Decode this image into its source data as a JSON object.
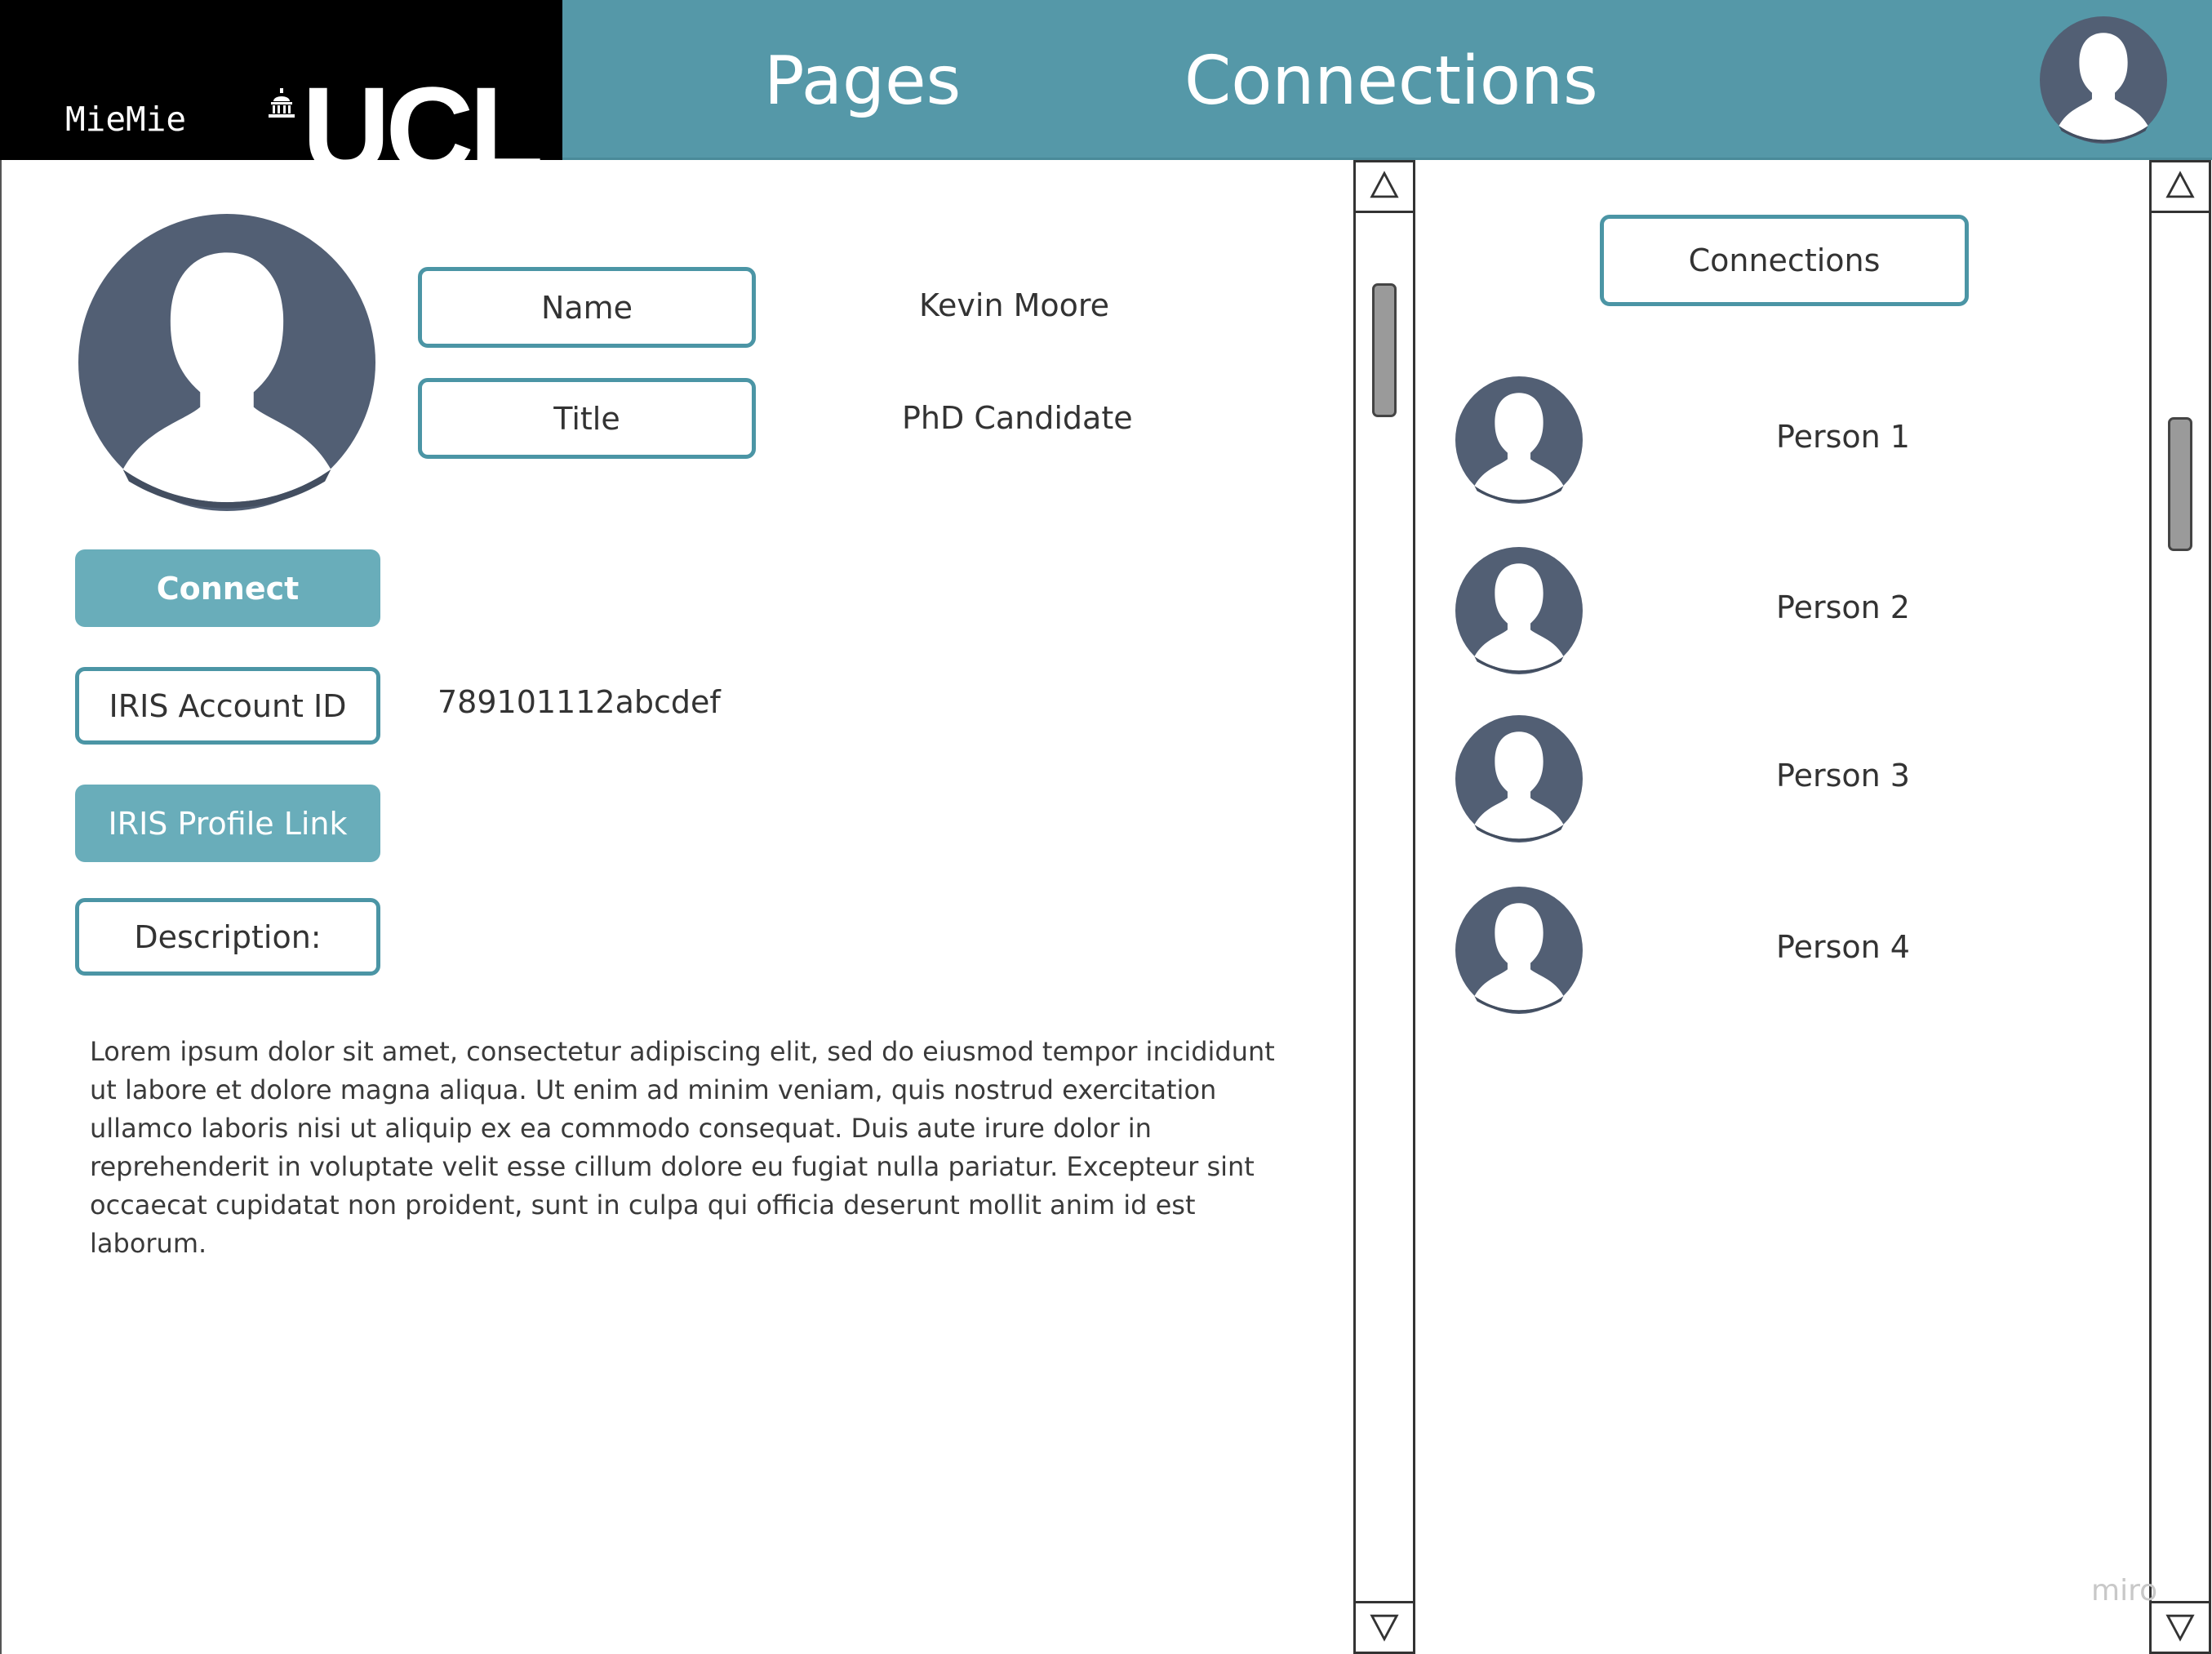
{
  "header": {
    "app_name": "MieMie",
    "logo_text": "UCL",
    "nav": [
      {
        "label": "Pages"
      },
      {
        "label": "Connections"
      }
    ]
  },
  "profile": {
    "name_label": "Name",
    "name_value": "Kevin Moore",
    "title_label": "Title",
    "title_value": "PhD Candidate",
    "connect_button": "Connect",
    "iris_id_label": "IRIS Account ID",
    "iris_id_value": "789101112abcdef",
    "iris_link_button": "IRIS Profile Link",
    "description_label": "Description:",
    "description_text": "Lorem ipsum dolor sit amet, consectetur adipiscing elit, sed do eiusmod tempor incididunt ut labore et dolore magna aliqua. Ut enim ad minim veniam, quis nostrud exercitation ullamco laboris nisi ut aliquip ex ea commodo consequat. Duis aute irure dolor in reprehenderit in voluptate velit esse cillum dolore eu fugiat nulla pariatur. Excepteur sint occaecat cupidatat non proident, sunt in culpa qui officia deserunt mollit anim id est laborum."
  },
  "connections": {
    "header_label": "Connections",
    "items": [
      {
        "name": "Person 1"
      },
      {
        "name": "Person 2"
      },
      {
        "name": "Person 3"
      },
      {
        "name": "Person 4"
      }
    ]
  },
  "watermark": "miro",
  "colors": {
    "header_bg": "#5598a8",
    "brand_bg": "#000000",
    "accent_border": "#4b95a5",
    "button_bg": "#69adba",
    "avatar_bg": "#525f74"
  }
}
